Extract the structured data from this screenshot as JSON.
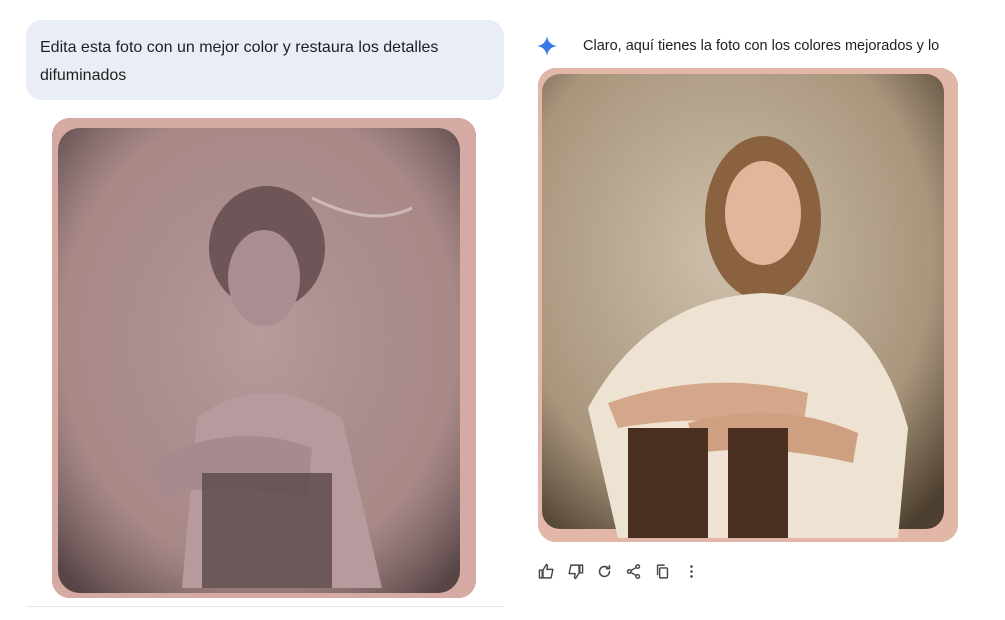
{
  "user_message": {
    "text": "Edita esta foto con un mejor color y restaura los detalles difuminados"
  },
  "model_response": {
    "text": "Claro, aquí tienes la foto con los colores mejorados y lo"
  },
  "images": {
    "original_alt": "tintype portrait of a woman seated on a chair, faded purple tone",
    "restored_alt": "restored portrait with natural colors"
  },
  "colors": {
    "user_bubble": "#e8edf6",
    "sparkle": "#3b78e7",
    "icon": "#444746"
  },
  "actions": [
    "thumb-up-icon",
    "thumb-down-icon",
    "regenerate-icon",
    "share-icon",
    "copy-icon",
    "more-vert-icon"
  ]
}
